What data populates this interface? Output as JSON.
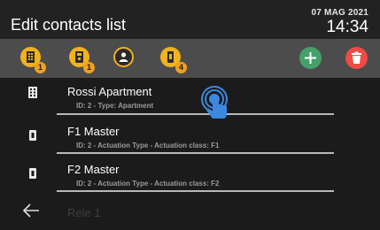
{
  "header": {
    "title": "Edit contacts list",
    "date": "07 MAG 2021",
    "time": "14:34"
  },
  "toolbar": {
    "filters": [
      {
        "icon": "building-contact-icon",
        "badge": "1"
      },
      {
        "icon": "entrance-panel-icon",
        "badge": "1"
      },
      {
        "icon": "person-contact-icon",
        "badge": ""
      },
      {
        "icon": "actuator-icon",
        "badge": "4"
      }
    ],
    "add_icon": "plus-icon",
    "delete_icon": "trash-icon"
  },
  "contacts": [
    {
      "name": "Rossi Apartment",
      "details": "ID: 2 - Type: Apartment",
      "icon": "building-icon"
    },
    {
      "name": "F1 Master",
      "details": "ID: 2 - Actuation Type - Actuation class: F1",
      "icon": "actuator-icon"
    },
    {
      "name": "F2 Master",
      "details": "ID: 2 - Actuation Type - Actuation class: F2",
      "icon": "actuator-icon"
    }
  ],
  "partial_item": "Rele 1",
  "colors": {
    "accent": "#f2b21b",
    "add": "#45a06a",
    "delete": "#f04b44",
    "toolbar": "#4c4c4c",
    "background": "#1b1b1b"
  }
}
